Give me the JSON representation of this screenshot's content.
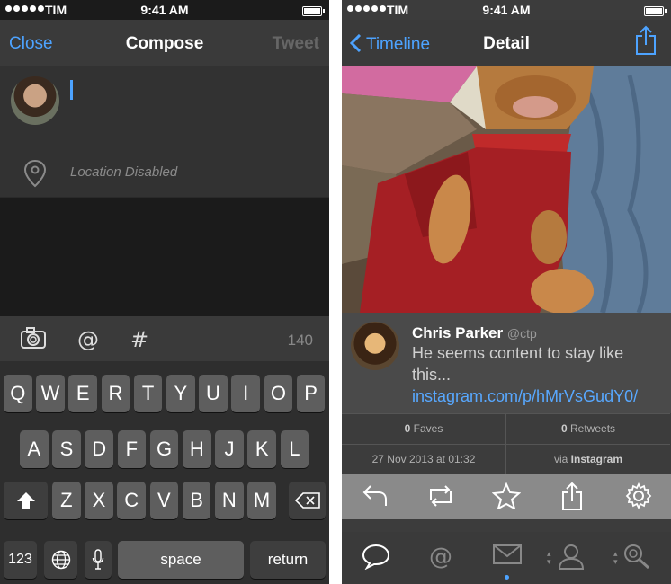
{
  "status": {
    "carrier": "TIM",
    "time": "9:41 AM"
  },
  "compose": {
    "nav": {
      "left": "Close",
      "title": "Compose",
      "right": "Tweet"
    },
    "location": "Location Disabled",
    "char_count": "140",
    "keyboard": {
      "row1": [
        "Q",
        "W",
        "E",
        "R",
        "T",
        "Y",
        "U",
        "I",
        "O",
        "P"
      ],
      "row2": [
        "A",
        "S",
        "D",
        "F",
        "G",
        "H",
        "J",
        "K",
        "L"
      ],
      "row3": [
        "Z",
        "X",
        "C",
        "V",
        "B",
        "N",
        "M"
      ],
      "num_key": "123",
      "space_key": "space",
      "return_key": "return"
    }
  },
  "detail": {
    "nav": {
      "back": "Timeline",
      "title": "Detail"
    },
    "tweet": {
      "name": "Chris Parker",
      "handle": "@ctp",
      "text": "He seems content to stay like this...",
      "link_text": "instagram.com/p/hMrVsGudY0/"
    },
    "stats": {
      "faves_count": "0",
      "faves_label": "Faves",
      "retweets_count": "0",
      "retweets_label": "Retweets",
      "date": "27 Nov 2013 at 01:32",
      "via_label": "via",
      "via_app": "Instagram"
    }
  },
  "colors": {
    "accent": "#4da3ff",
    "link": "#58a8ff"
  }
}
